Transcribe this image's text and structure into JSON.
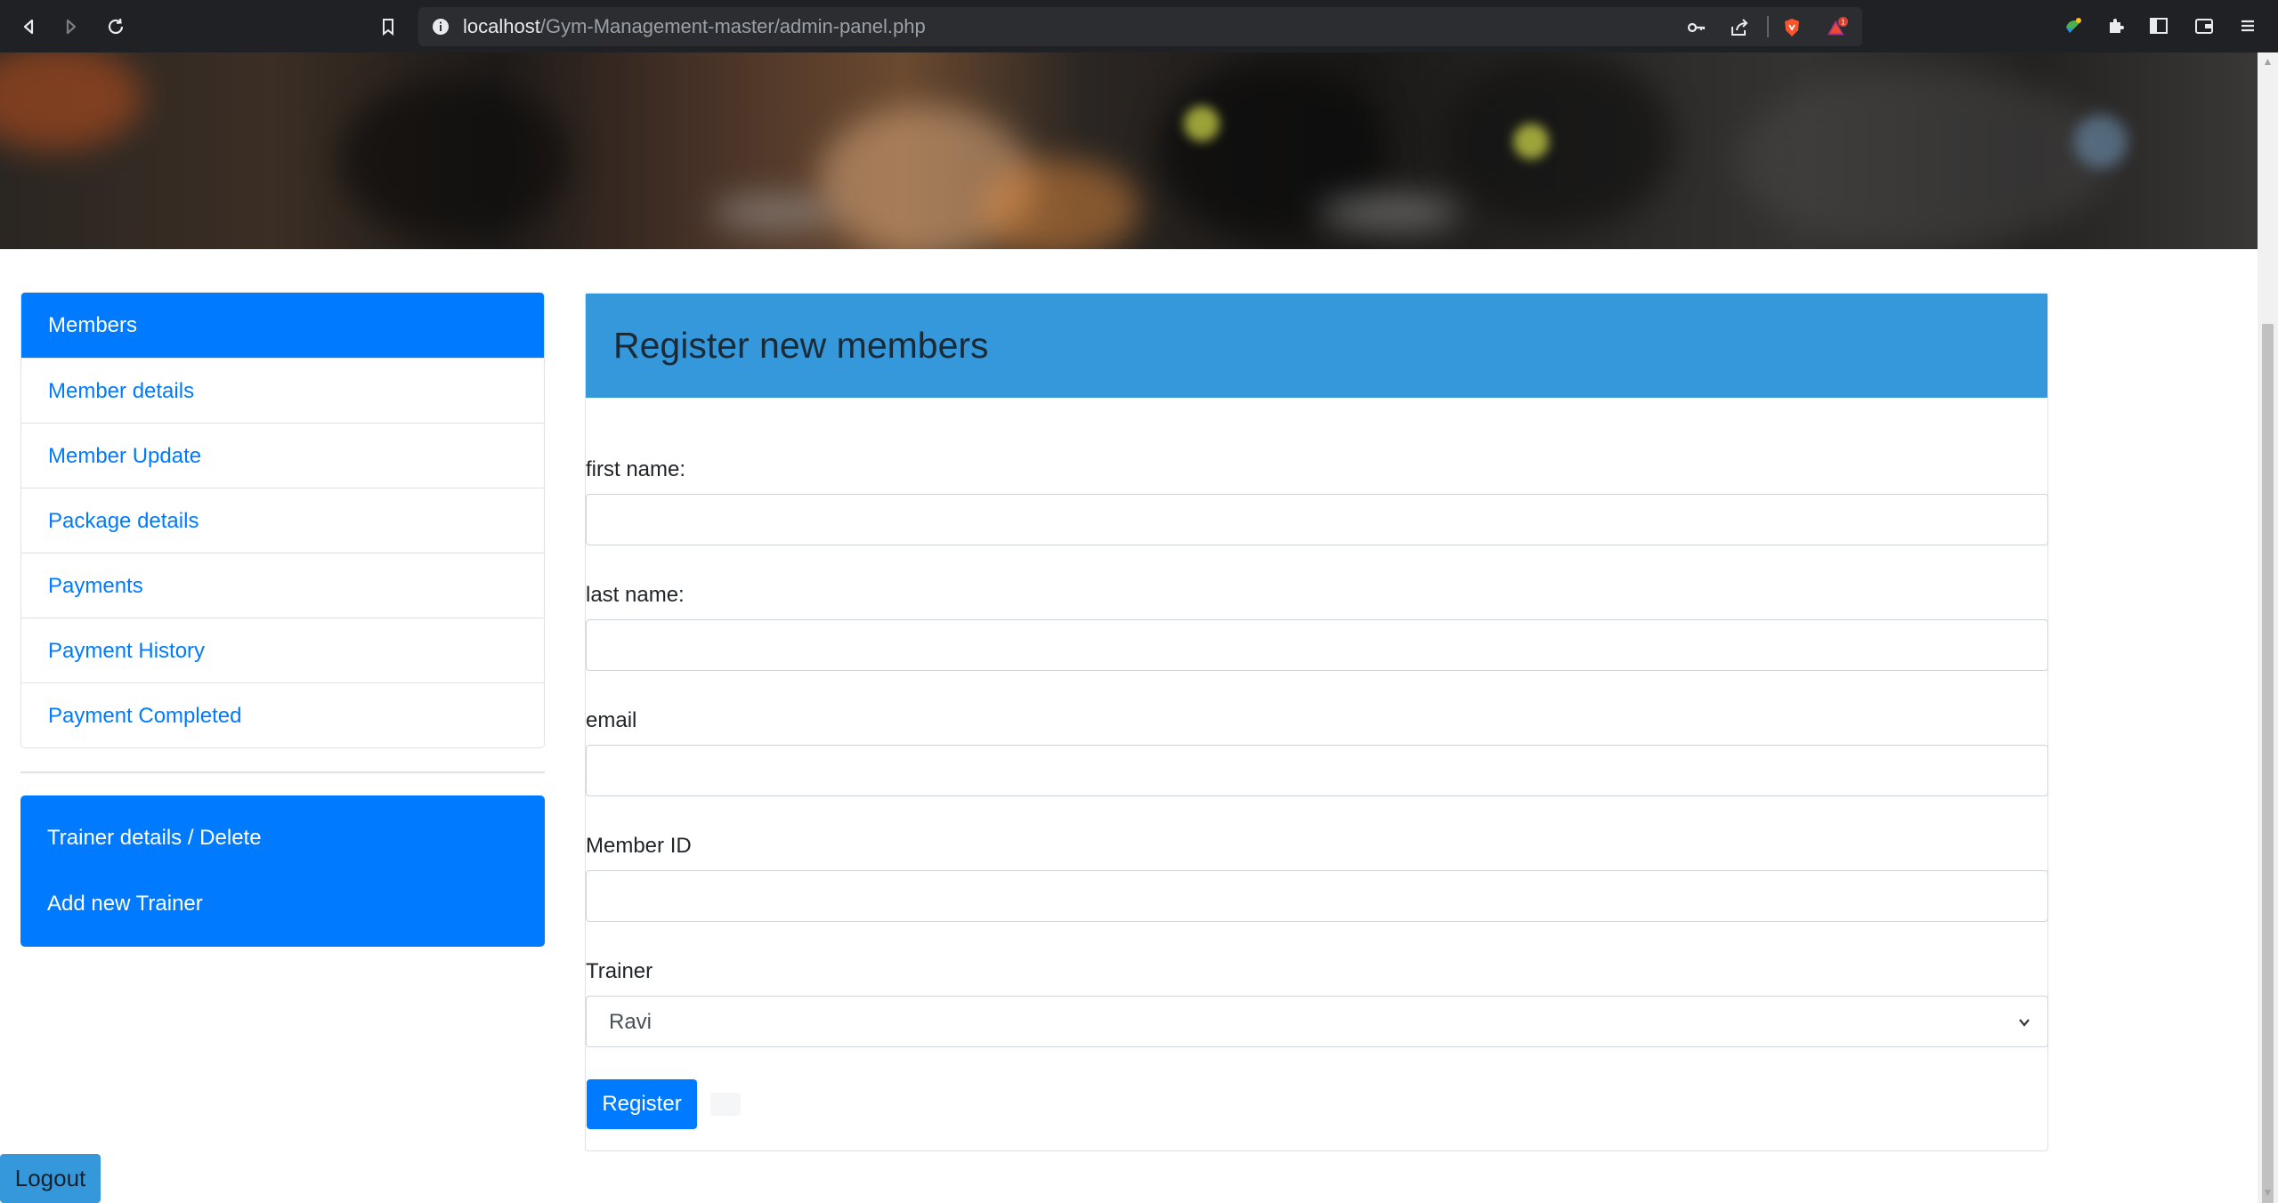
{
  "browser": {
    "url_host": "localhost",
    "url_path": "/Gym-Management-master/admin-panel.php",
    "notification_count": "1"
  },
  "sidebar": {
    "members_items": [
      {
        "label": "Members",
        "active": true
      },
      {
        "label": "Member details"
      },
      {
        "label": "Member Update"
      },
      {
        "label": "Package details"
      },
      {
        "label": "Payments"
      },
      {
        "label": "Payment History"
      },
      {
        "label": "Payment Completed"
      }
    ],
    "trainer_items": [
      {
        "label": "Trainer details / Delete"
      },
      {
        "label": "Add new Trainer"
      }
    ]
  },
  "form": {
    "title": "Register new members",
    "fields": [
      {
        "label": "first name:",
        "value": ""
      },
      {
        "label": "last name:",
        "value": ""
      },
      {
        "label": "email",
        "value": ""
      },
      {
        "label": "Member ID",
        "value": ""
      },
      {
        "label": "Trainer",
        "selected": "Ravi"
      }
    ],
    "submit_label": "Register"
  },
  "logout_label": "Logout",
  "colors": {
    "primary": "#007bff",
    "header": "#3498db",
    "chrome": "#202124"
  }
}
